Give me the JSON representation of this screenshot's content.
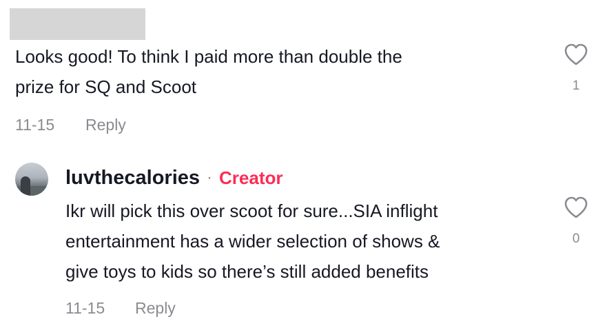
{
  "comment_1": {
    "text_line_1": "Looks good! To think I paid more than double the",
    "text_line_2": "prize for SQ and Scoot",
    "date": "11-15",
    "reply_label": "Reply",
    "like_count": "1"
  },
  "comment_2": {
    "author": "luvthecalories",
    "separator": "·",
    "badge": "Creator",
    "text_line_1": "Ikr will pick this over scoot for sure...SIA inflight",
    "text_line_2": "entertainment has a wider selection of shows &",
    "text_line_3": "give toys to kids so there’s still added benefits",
    "date": "11-15",
    "reply_label": "Reply",
    "like_count": "0"
  },
  "icons": {
    "like": "heart-outline-icon"
  },
  "colors": {
    "text": "#161823",
    "muted": "#8a8b91",
    "creator": "#fe2c55",
    "redaction": "#d6d6d6"
  }
}
